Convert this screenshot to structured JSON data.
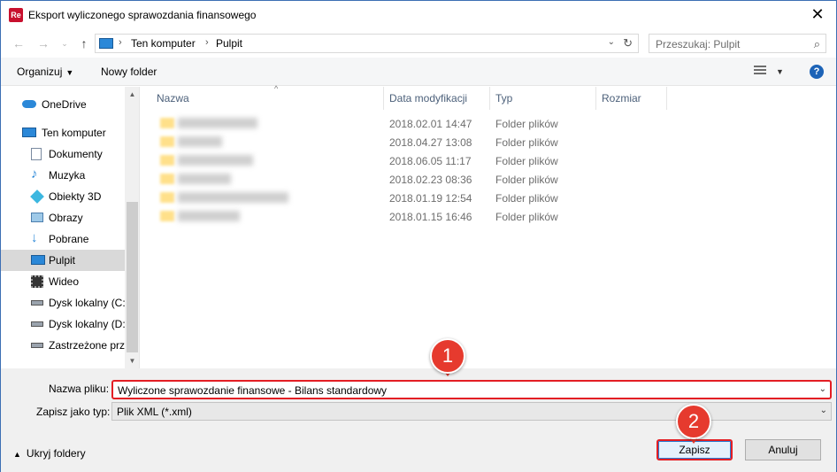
{
  "window": {
    "title": "Eksport wyliczonego sprawozdania finansowego",
    "app_icon_text": "Re",
    "close_label": "✕"
  },
  "address_bar": {
    "breadcrumbs": [
      "Ten komputer",
      "Pulpit"
    ],
    "search_placeholder": "Przeszukaj: Pulpit"
  },
  "toolbar": {
    "organize_label": "Organizuj",
    "new_folder_label": "Nowy folder",
    "help_label": "?"
  },
  "nav_pane": {
    "items": [
      {
        "label": "OneDrive",
        "icon": "onedrive-icon"
      },
      {
        "label": "Ten komputer",
        "icon": "computer-icon"
      },
      {
        "label": "Dokumenty",
        "icon": "documents-icon"
      },
      {
        "label": "Muzyka",
        "icon": "music-icon"
      },
      {
        "label": "Obiekty 3D",
        "icon": "3d-objects-icon"
      },
      {
        "label": "Obrazy",
        "icon": "pictures-icon"
      },
      {
        "label": "Pobrane",
        "icon": "downloads-icon"
      },
      {
        "label": "Pulpit",
        "icon": "desktop-icon",
        "selected": true
      },
      {
        "label": "Wideo",
        "icon": "videos-icon"
      },
      {
        "label": "Dysk lokalny (C:)",
        "icon": "drive-icon"
      },
      {
        "label": "Dysk lokalny (D:)",
        "icon": "drive-icon"
      },
      {
        "label": "Zastrzeżone prze",
        "icon": "drive-icon"
      }
    ]
  },
  "file_list": {
    "columns": [
      "Nazwa",
      "Data modyfikacji",
      "Typ",
      "Rozmiar"
    ],
    "rows": [
      {
        "date": "2018.02.01 14:47",
        "type": "Folder plików"
      },
      {
        "date": "2018.04.27 13:08",
        "type": "Folder plików"
      },
      {
        "date": "2018.06.05 11:17",
        "type": "Folder plików"
      },
      {
        "date": "2018.02.23 08:36",
        "type": "Folder plików"
      },
      {
        "date": "2018.01.19 12:54",
        "type": "Folder plików"
      },
      {
        "date": "2018.01.15 16:46",
        "type": "Folder plików"
      }
    ]
  },
  "save_form": {
    "filename_label": "Nazwa pliku:",
    "filename_value": "Wyliczone sprawozdanie finansowe - Bilans standardowy",
    "filetype_label": "Zapisz jako typ:",
    "filetype_value": "Plik XML (*.xml)",
    "hide_folders_label": "Ukryj foldery",
    "save_label": "Zapisz",
    "cancel_label": "Anuluj"
  },
  "callouts": [
    "1",
    "2"
  ],
  "colors": {
    "accent": "#1c63b7",
    "highlight_border": "#e31e24",
    "badge": "#e63a2e"
  }
}
